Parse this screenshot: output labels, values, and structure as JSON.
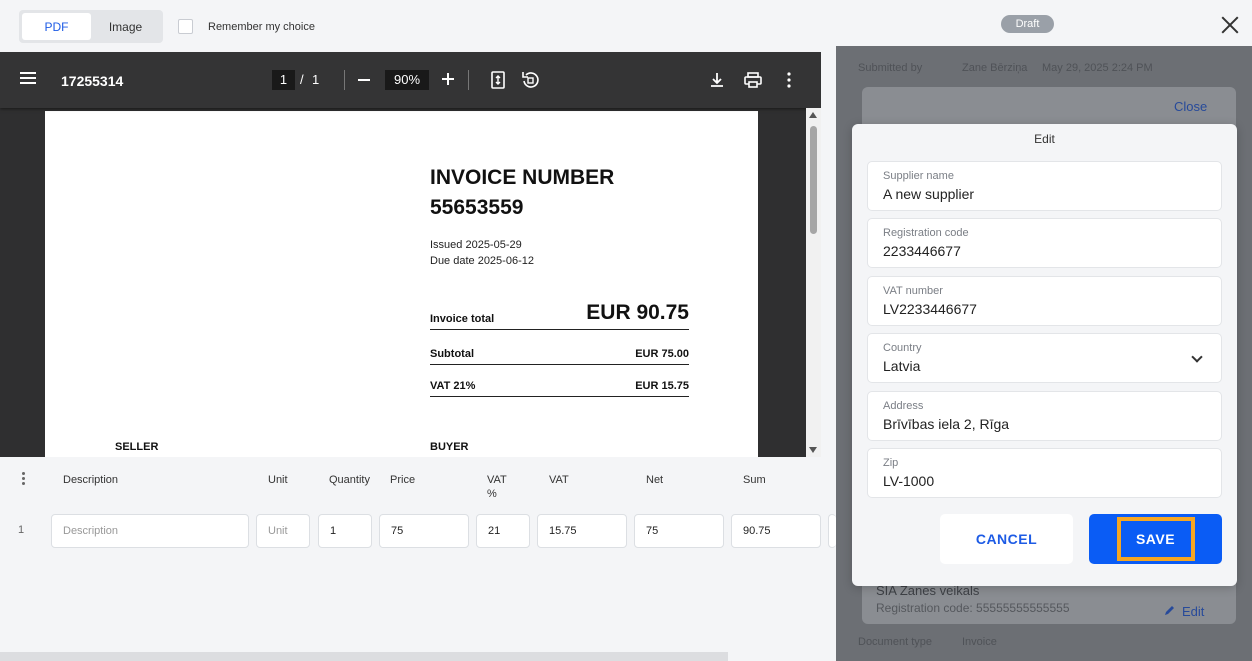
{
  "view_toggle": {
    "pdf": "PDF",
    "image": "Image"
  },
  "remember_choice": "Remember my choice",
  "viewer": {
    "document_name": "17255314",
    "current_page": "1",
    "separator": "/",
    "total_pages": "1",
    "zoom": "90%"
  },
  "invoice": {
    "title_line1": "INVOICE NUMBER",
    "title_line2": "55653559",
    "issued": "Issued 2025-05-29",
    "due": "Due date 2025-06-12",
    "total_label": "Invoice total",
    "total_value": "EUR 90.75",
    "subtotal_label": "Subtotal",
    "subtotal_value": "EUR 75.00",
    "vat_label": "VAT 21%",
    "vat_value": "EUR 15.75",
    "seller": "SELLER",
    "buyer": "BUYER"
  },
  "lines": {
    "headers": {
      "description": "Description",
      "unit": "Unit",
      "quantity": "Quantity",
      "price": "Price",
      "vat_pct_line1": "VAT",
      "vat_pct_line2": "%",
      "vat": "VAT",
      "net": "Net",
      "sum": "Sum"
    },
    "row": {
      "index": "1",
      "description_placeholder": "Description",
      "unit_placeholder": "Unit",
      "quantity": "1",
      "price": "75",
      "vat_pct": "21",
      "vat": "15.75",
      "net": "75",
      "sum": "90.75"
    }
  },
  "panel": {
    "status": "Draft",
    "submitted_by_label": "Submitted by",
    "submitted_by_value": "Zane Bērziņa",
    "submitted_date": "May 29, 2025 2:24 PM",
    "close_link": "Close",
    "supplier_bg": "SIA Zanes veikals",
    "registration_bg": "Registration code: 55555555555555",
    "edit_link": "Edit",
    "document_type_label": "Document type",
    "document_type_value": "Invoice"
  },
  "edit_modal": {
    "title": "Edit",
    "fields": [
      {
        "label": "Supplier name",
        "value": "A new supplier"
      },
      {
        "label": "Registration code",
        "value": "2233446677"
      },
      {
        "label": "VAT number",
        "value": "LV2233446677"
      },
      {
        "label": "Country",
        "value": "Latvia"
      },
      {
        "label": "Address",
        "value": "Brīvības iela 2, Rīga"
      },
      {
        "label": "Zip",
        "value": "LV-1000"
      }
    ],
    "cancel": "CANCEL",
    "save": "SAVE"
  },
  "colors": {
    "accent": "#0a5cf5",
    "highlight_border": "#f5a623",
    "draft_badge": "#9aa0a8"
  }
}
